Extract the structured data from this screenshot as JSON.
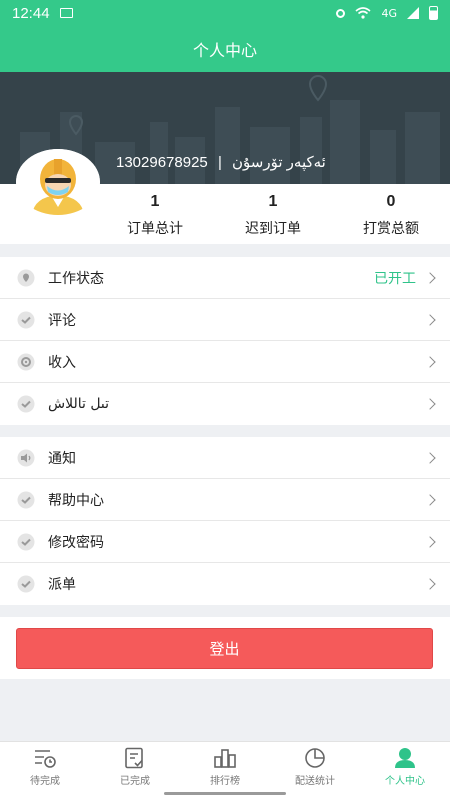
{
  "status_bar": {
    "time": "12:44",
    "signal": "4G"
  },
  "header": {
    "title": "个人中心"
  },
  "profile": {
    "phone": "13029678925",
    "separator": "|",
    "name": "ئەكپەر تۆرسۇن"
  },
  "stats": [
    {
      "value": "1",
      "label": "订单总计"
    },
    {
      "value": "1",
      "label": "迟到订单"
    },
    {
      "value": "0",
      "label": "打赏总额"
    }
  ],
  "menu_group_1": [
    {
      "label": "工作状态",
      "value": "已开工",
      "icon": "location-pin-icon"
    },
    {
      "label": "评论",
      "value": "",
      "icon": "check-badge-icon"
    },
    {
      "label": "收入",
      "value": "",
      "icon": "gear-icon"
    },
    {
      "label": "تىل تاللاش",
      "value": "",
      "icon": "check-badge-icon"
    }
  ],
  "menu_group_2": [
    {
      "label": "通知",
      "icon": "speaker-icon"
    },
    {
      "label": "帮助中心",
      "icon": "check-badge-icon"
    },
    {
      "label": "修改密码",
      "icon": "check-badge-icon"
    },
    {
      "label": "派单",
      "icon": "check-badge-icon"
    }
  ],
  "logout": {
    "label": "登出"
  },
  "tabs": [
    {
      "label": "待完成",
      "icon": "pending-list-icon"
    },
    {
      "label": "已完成",
      "icon": "completed-doc-icon"
    },
    {
      "label": "排行榜",
      "icon": "bar-chart-icon"
    },
    {
      "label": "配送统计",
      "icon": "pie-chart-icon"
    },
    {
      "label": "个人中心",
      "icon": "person-icon",
      "active": true
    }
  ],
  "colors": {
    "primary": "#34c98a",
    "banner": "#35434a",
    "logout": "#f55a5a",
    "status_on": "#2fc38a"
  }
}
